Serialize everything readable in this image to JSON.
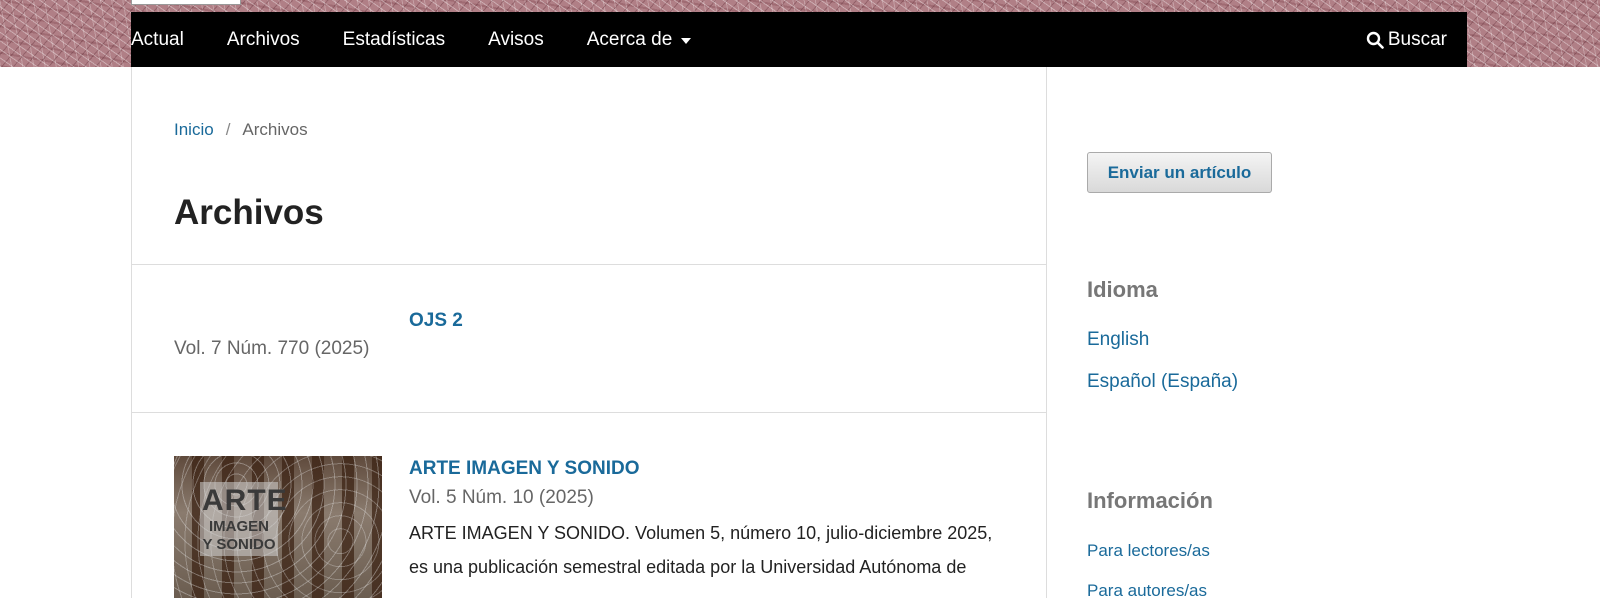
{
  "nav": {
    "items": [
      "Actual",
      "Archivos",
      "Estadísticas",
      "Avisos",
      "Acerca de"
    ],
    "search_label": "Buscar"
  },
  "breadcrumb": {
    "home": "Inicio",
    "separator": "/",
    "current": "Archivos"
  },
  "page_title": "Archivos",
  "issues": [
    {
      "title": "OJS 2",
      "volume": "Vol. 7 Núm. 770 (2025)"
    },
    {
      "title": "ARTE IMAGEN Y SONIDO",
      "volume": "Vol. 5 Núm. 10 (2025)",
      "description": "ARTE IMAGEN Y SONIDO. Volumen 5, número 10, julio-diciembre 2025, es una publicación semestral editada por la Universidad Autónoma de",
      "cover_text_big": "ARTE",
      "cover_text_line2": "IMAGEN",
      "cover_text_line3": "Y SONIDO"
    }
  ],
  "sidebar": {
    "submit_button": "Enviar un artículo",
    "language_heading": "Idioma",
    "languages": [
      "English",
      "Español (España)"
    ],
    "info_heading": "Información",
    "info_links": [
      "Para lectores/as",
      "Para autores/as"
    ]
  },
  "colors": {
    "link": "#1a6a9a",
    "navbar": "#000000",
    "heading_gray": "#777777"
  }
}
